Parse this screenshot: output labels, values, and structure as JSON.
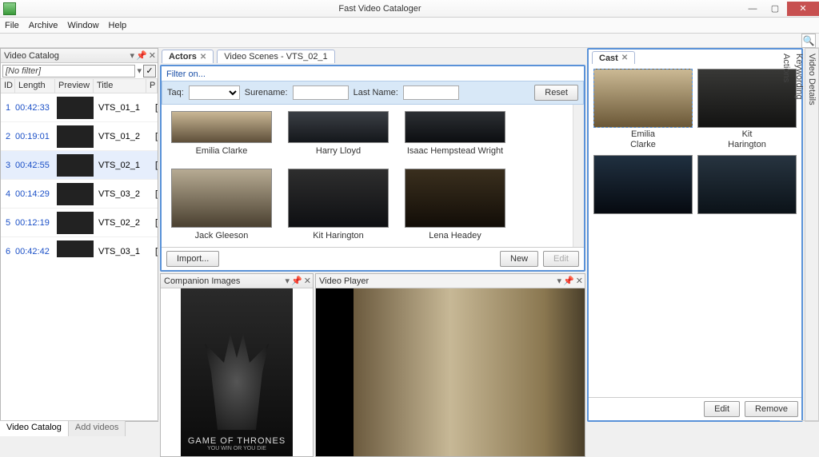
{
  "app": {
    "title": "Fast Video Cataloger"
  },
  "menu": {
    "file": "File",
    "archive": "Archive",
    "window": "Window",
    "help": "Help"
  },
  "catalog": {
    "title": "Video Catalog",
    "filter_placeholder": "[No filter]",
    "cols": {
      "id": "ID",
      "length": "Length",
      "preview": "Preview",
      "title": "Title",
      "p": "P"
    },
    "rows": [
      {
        "id": "1",
        "len": "00:42:33",
        "title": "VTS_01_1",
        "p": "["
      },
      {
        "id": "2",
        "len": "00:19:01",
        "title": "VTS_01_2",
        "p": "["
      },
      {
        "id": "3",
        "len": "00:42:55",
        "title": "VTS_02_1",
        "p": "["
      },
      {
        "id": "4",
        "len": "00:14:29",
        "title": "VTS_03_2",
        "p": "["
      },
      {
        "id": "5",
        "len": "00:12:19",
        "title": "VTS_02_2",
        "p": "["
      },
      {
        "id": "6",
        "len": "00:42:42",
        "title": "VTS_03_1",
        "p": "["
      }
    ],
    "tabs": {
      "catalog": "Video Catalog",
      "add": "Add videos"
    }
  },
  "centerTabs": {
    "actors": "Actors",
    "scenes": "Video Scenes - VTS_02_1"
  },
  "actors": {
    "filter_on": "Filter on...",
    "tag": "Taq:",
    "surename": "Surename:",
    "lastname": "Last Name:",
    "reset": "Reset",
    "row1": [
      "Emilia Clarke",
      "Harry Lloyd",
      "Isaac Hempstead Wright"
    ],
    "row2": [
      "Jack Gleeson",
      "Kit Harington",
      "Lena Headey"
    ],
    "import": "Import...",
    "new": "New",
    "edit": "Edit"
  },
  "companion": {
    "title": "Companion Images",
    "poster_title": "GAME OF THRONES",
    "poster_sub": "YOU WIN OR YOU DIE"
  },
  "player": {
    "title": "Video Player"
  },
  "cast": {
    "title": "Cast",
    "items": [
      {
        "first": "Emilia",
        "last": "Clarke"
      },
      {
        "first": "Kit",
        "last": "Harington"
      }
    ],
    "edit": "Edit",
    "remove": "Remove"
  },
  "sideTabs": {
    "details": "Video Details",
    "keywording": "Keywording",
    "actions": "Actions"
  }
}
